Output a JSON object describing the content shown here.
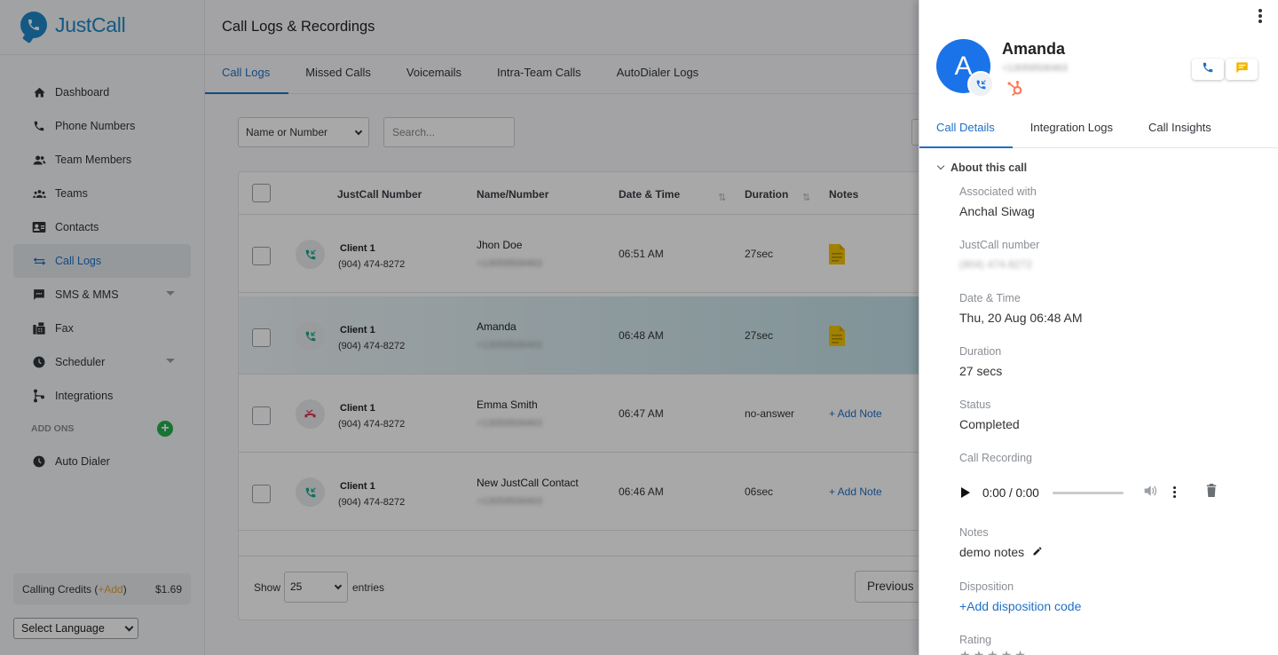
{
  "brand": {
    "name": "JustCall"
  },
  "sidebar": {
    "items": [
      {
        "label": "Dashboard",
        "icon": "home-icon"
      },
      {
        "label": "Phone Numbers",
        "icon": "phone-icon"
      },
      {
        "label": "Team Members",
        "icon": "team-members-icon"
      },
      {
        "label": "Teams",
        "icon": "teams-icon"
      },
      {
        "label": "Contacts",
        "icon": "contacts-icon"
      },
      {
        "label": "Call Logs",
        "icon": "call-logs-icon",
        "active": true
      },
      {
        "label": "SMS & MMS",
        "icon": "sms-icon",
        "expandable": true
      },
      {
        "label": "Fax",
        "icon": "fax-icon"
      },
      {
        "label": "Scheduler",
        "icon": "scheduler-icon",
        "expandable": true
      },
      {
        "label": "Integrations",
        "icon": "integrations-icon"
      }
    ],
    "addons_label": "ADD ONS",
    "addons_items": [
      {
        "label": "Auto Dialer",
        "icon": "auto-dialer-icon"
      }
    ],
    "credits": {
      "label": "Calling Credits (",
      "add": "+Add",
      "close": ")",
      "amount": "$1.69"
    },
    "language": "Select Language"
  },
  "main": {
    "title": "Call Logs & Recordings",
    "tabs": [
      "Call Logs",
      "Missed Calls",
      "Voicemails",
      "Intra-Team Calls",
      "AutoDialer Logs"
    ],
    "filter": {
      "selected": "Name or Number",
      "search_placeholder": "Search..."
    },
    "table": {
      "headers": {
        "number": "JustCall Number",
        "name": "Name/Number",
        "datetime": "Date & Time",
        "duration": "Duration",
        "notes": "Notes"
      },
      "rows": [
        {
          "client": "Client 1",
          "client_number": "(904) 474-8272",
          "name": "Jhon Doe",
          "number": "+13059506463",
          "time": "06:51 AM",
          "duration": "27sec",
          "note_type": "icon",
          "call_icon": "incoming-call-icon"
        },
        {
          "client": "Client 1",
          "client_number": "(904) 474-8272",
          "name": "Amanda",
          "number": "+13059506463",
          "time": "06:48 AM",
          "duration": "27sec",
          "note_type": "icon",
          "call_icon": "incoming-call-icon",
          "highlighted": true
        },
        {
          "client": "Client 1",
          "client_number": "(904) 474-8272",
          "name": "Emma Smith",
          "number": "+13059506463",
          "time": "06:47 AM",
          "duration": "no-answer",
          "note_type": "link",
          "note_text": "+ Add Note",
          "call_icon": "missed-call-icon"
        },
        {
          "client": "Client 1",
          "client_number": "(904) 474-8272",
          "name": "New JustCall Contact",
          "number": "+13059506463",
          "time": "06:46 AM",
          "duration": "06sec",
          "note_type": "link",
          "note_text": "+ Add Note",
          "call_icon": "incoming-call-icon"
        }
      ],
      "show_label": "Show",
      "entries_value": "25",
      "entries_label": "entries",
      "previous": "Previous"
    }
  },
  "details": {
    "avatar_letter": "A",
    "name": "Amanda",
    "number": "+13059506463",
    "tabs": [
      "Call Details",
      "Integration Logs",
      "Call Insights"
    ],
    "section_title": "About this call",
    "fields": {
      "associated_label": "Associated with",
      "associated_value": "Anchal Siwag",
      "jc_number_label": "JustCall number",
      "jc_number_value": "(904) 474-8272",
      "datetime_label": "Date & Time",
      "datetime_value": "Thu, 20 Aug 06:48 AM",
      "duration_label": "Duration",
      "duration_value": "27 secs",
      "status_label": "Status",
      "status_value": "Completed",
      "recording_label": "Call Recording",
      "recording_time": "0:00 / 0:00",
      "notes_label": "Notes",
      "notes_value": "demo notes",
      "disposition_label": "Disposition",
      "disposition_link": "+Add disposition code",
      "rating_label": "Rating"
    },
    "colors": {
      "accent": "#1f6fc6",
      "avatar": "#1a73e8",
      "hubspot": "#ff7a59",
      "message": "#f5b400"
    }
  }
}
